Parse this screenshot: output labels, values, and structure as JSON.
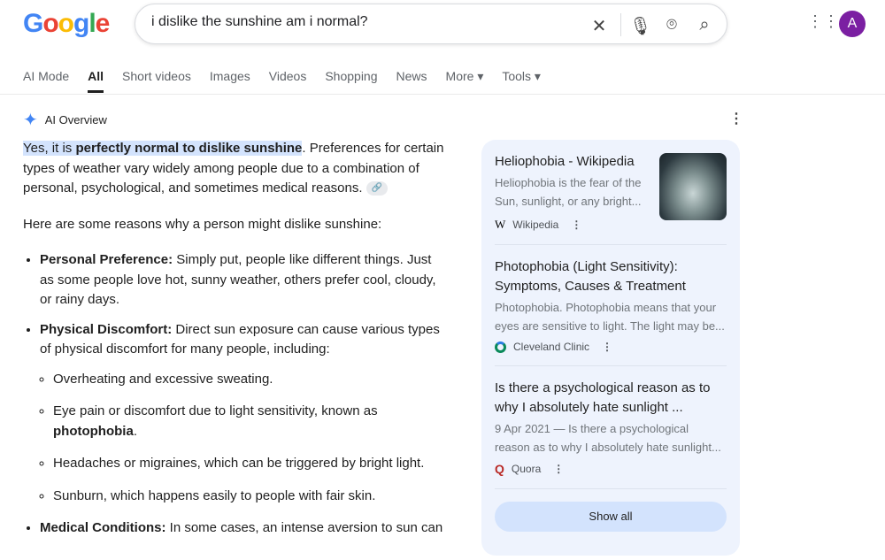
{
  "header": {
    "logo": "Google",
    "query": "i dislike the sunshine am i normal?",
    "avatar": "A"
  },
  "tabs": [
    "AI Mode",
    "All",
    "Short videos",
    "Images",
    "Videos",
    "Shopping",
    "News",
    "More ▾",
    "Tools ▾"
  ],
  "overview": {
    "title": "AI Overview",
    "intro_hl1": "Yes, it is ",
    "intro_hl2": "perfectly normal to dislike sunshine",
    "intro_rest": ". Preferences for certain types of weather vary widely among people due to a combination of personal, psychological, and sometimes medical reasons.",
    "lead": "Here are some reasons why a person might dislike sunshine:",
    "b1_head": "Personal Preference:",
    "b1_text": " Simply put, people like different things. Just as some people love hot, sunny weather, others prefer cool, cloudy, or rainy days.",
    "b2_head": "Physical Discomfort:",
    "b2_text": " Direct sun exposure can cause various types of physical discomfort for many people, including:",
    "s1": "Overheating and excessive sweating.",
    "s2a": "Eye pain or discomfort due to light sensitivity, known as ",
    "s2b": "photophobia",
    "s2c": ".",
    "s3": "Headaches or migraines, which can be triggered by bright light.",
    "s4": "Sunburn, which happens easily to people with fair skin.",
    "b3_head": "Medical Conditions:",
    "b3_text": " In some cases, an intense aversion to sun can"
  },
  "sources": [
    {
      "title": "Heliophobia - Wikipedia",
      "snippet": "Heliophobia is the fear of the Sun, sunlight, or any bright...",
      "site": "Wikipedia"
    },
    {
      "title": "Photophobia (Light Sensitivity): Symptoms, Causes & Treatment",
      "snippet": "Photophobia. Photophobia means that your eyes are sensitive to light. The light may be...",
      "site": "Cleveland Clinic"
    },
    {
      "title": "Is there a psychological reason as to why I absolutely hate sunlight ...",
      "snippet": "9 Apr 2021 — Is there a psychological reason as to why I absolutely hate sunlight...",
      "site": "Quora"
    }
  ],
  "show_all": "Show all"
}
